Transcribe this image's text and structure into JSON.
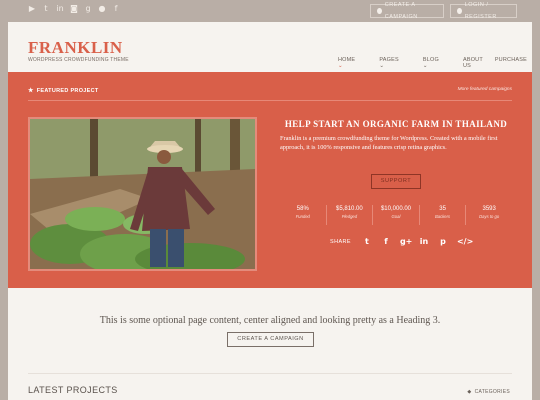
{
  "topbar": {
    "social_icons": [
      "youtube-icon",
      "twitter-icon",
      "linkedin-icon",
      "instagram-icon",
      "google-plus-icon",
      "flickr-icon",
      "facebook-icon"
    ],
    "create_campaign_label": "CREATE A CAMPAIGN",
    "login_label": "LOGIN / REGISTER"
  },
  "header": {
    "logo": "FRANKLIN",
    "tagline": "WORDPRESS CROWDFUNDING THEME",
    "nav": [
      {
        "label": "HOME",
        "active": true,
        "has_dropdown": true
      },
      {
        "label": "PAGES",
        "has_dropdown": true
      },
      {
        "label": "BLOG",
        "has_dropdown": true
      },
      {
        "label": "ABOUT US"
      },
      {
        "label": "PURCHASE"
      }
    ]
  },
  "featured": {
    "heading": "FEATURED PROJECT",
    "more_link": "More featured campaigns",
    "title": "HELP START AN ORGANIC FARM IN THAILAND",
    "description": "Franklin is a premium crowdfunding theme for Wordpress. Created with a mobile first approach, it is 100% responsive and features crisp retina graphics.",
    "support_label": "SUPPORT",
    "stats": [
      {
        "value": "58%",
        "label": "Funded"
      },
      {
        "value": "$5,810.00",
        "label": "Pledged"
      },
      {
        "value": "$10,000.00",
        "label": "Goal"
      },
      {
        "value": "35",
        "label": "Backers"
      },
      {
        "value": "3593",
        "label": "Days to go"
      }
    ],
    "share_label": "SHARE",
    "share_icons": [
      "twitter-icon",
      "facebook-icon",
      "google-plus-icon",
      "linkedin-icon",
      "pinterest-icon",
      "embed-icon"
    ]
  },
  "content": {
    "heading": "This is some optional page content, center aligned and looking pretty as a Heading 3.",
    "create_campaign_label": "CREATE A CAMPAIGN"
  },
  "latest": {
    "heading": "LATEST PROJECTS",
    "categories_label": "CATEGORIES"
  },
  "colors": {
    "accent": "#d95f49",
    "background": "#b9aea6",
    "sheet": "#f6f3ef"
  }
}
